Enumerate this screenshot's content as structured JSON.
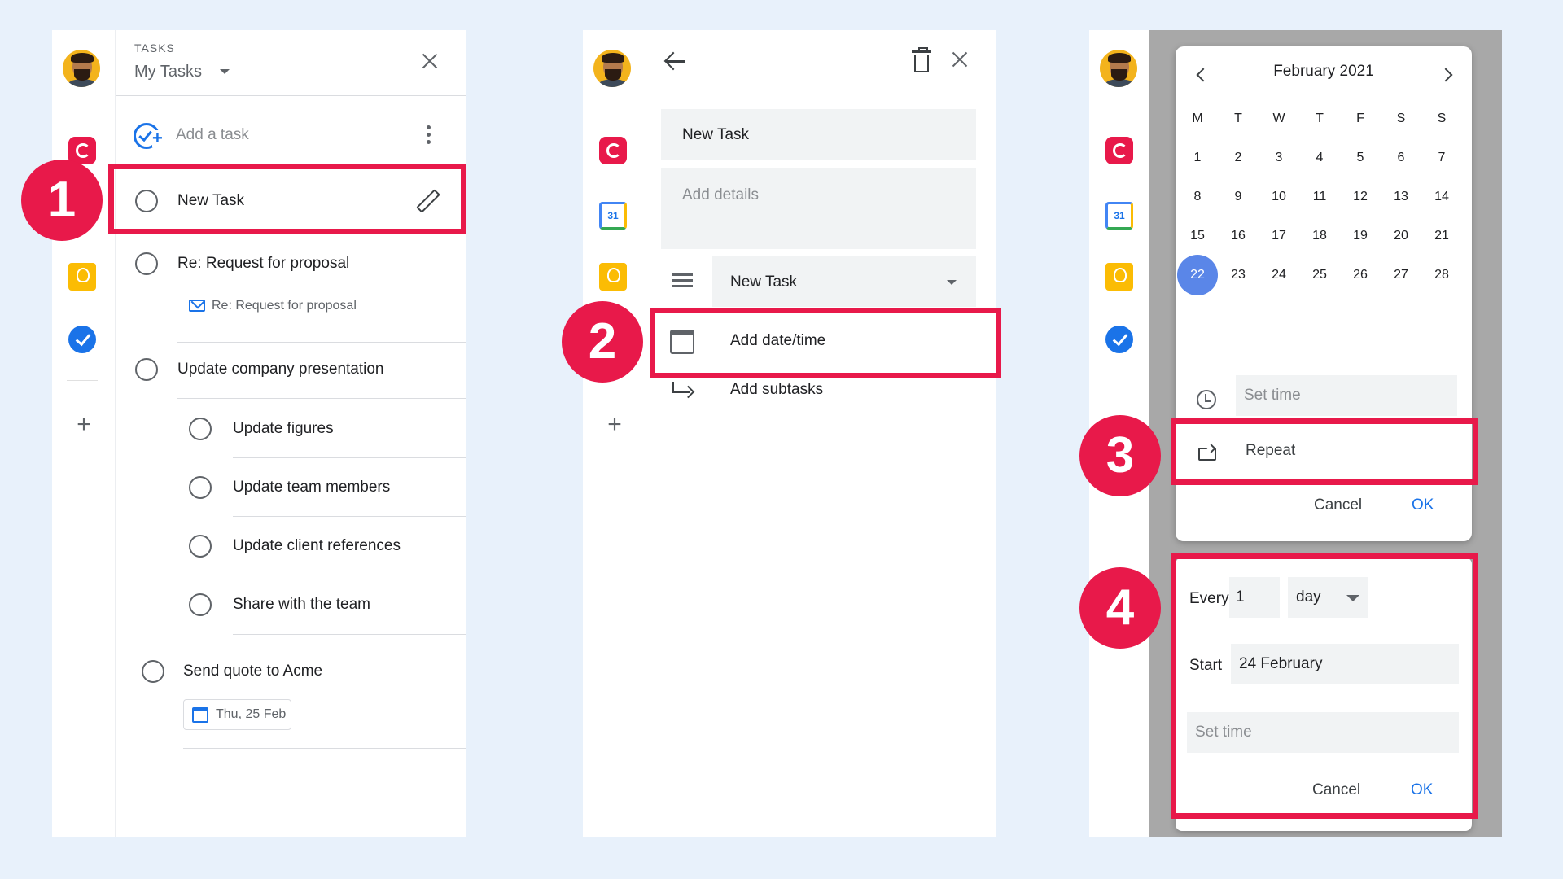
{
  "colors": {
    "background": "#e8f1fb",
    "accent_red": "#e8194a",
    "accent_blue": "#1a73e8",
    "selected_day": "#5a86e8"
  },
  "steps": [
    "1",
    "2",
    "3",
    "4"
  ],
  "rail": {
    "calendar_badge": "31"
  },
  "panel1": {
    "header_small": "TASKS",
    "header_title": "My Tasks",
    "add_task": "Add a task",
    "tasks": [
      {
        "title": "New Task"
      },
      {
        "title": "Re: Request for proposal",
        "link": "Re: Request for proposal"
      },
      {
        "title": "Update company presentation"
      },
      {
        "title": "Update figures"
      },
      {
        "title": "Update team members"
      },
      {
        "title": "Update client references"
      },
      {
        "title": "Share with the team"
      },
      {
        "title": "Send quote to Acme",
        "date": "Thu, 25 Feb"
      }
    ]
  },
  "panel2": {
    "task_title": "New Task",
    "details_placeholder": "Add details",
    "list_name": "New Task",
    "add_date": "Add date/time",
    "add_subtasks": "Add subtasks"
  },
  "panel3": {
    "month": "February 2021",
    "weekdays": [
      "M",
      "T",
      "W",
      "T",
      "F",
      "S",
      "S"
    ],
    "weeks": [
      [
        "1",
        "2",
        "3",
        "4",
        "5",
        "6",
        "7"
      ],
      [
        "8",
        "9",
        "10",
        "11",
        "12",
        "13",
        "14"
      ],
      [
        "15",
        "16",
        "17",
        "18",
        "19",
        "20",
        "21"
      ],
      [
        "22",
        "23",
        "24",
        "25",
        "26",
        "27",
        "28"
      ]
    ],
    "selected_day": "22",
    "set_time": "Set time",
    "repeat": "Repeat",
    "cancel": "Cancel",
    "ok": "OK",
    "repeat_dialog": {
      "every_label": "Every",
      "every_value": "1",
      "unit": "day",
      "start_label": "Start",
      "start_value": "24 February",
      "set_time": "Set time",
      "cancel": "Cancel",
      "ok": "OK"
    }
  }
}
